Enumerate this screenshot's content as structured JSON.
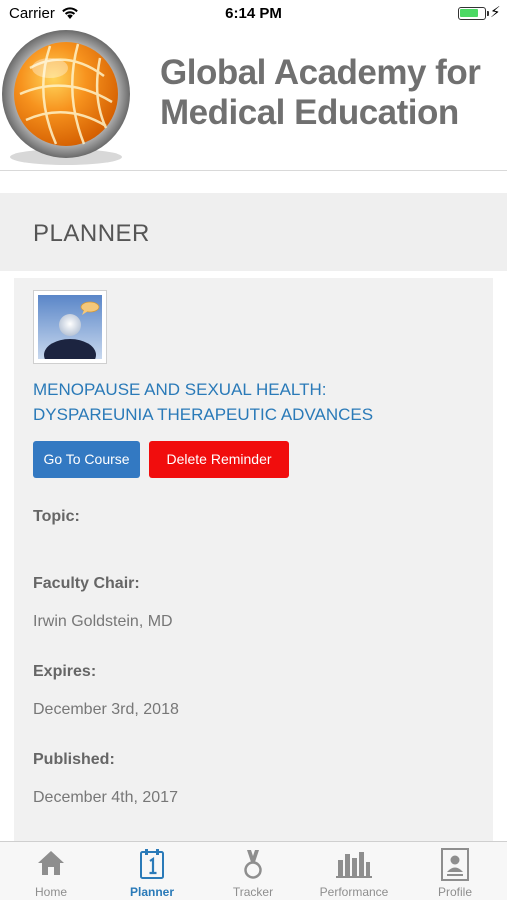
{
  "status_bar": {
    "carrier": "Carrier",
    "time": "6:14 PM",
    "icons": [
      "wifi-icon",
      "battery-icon",
      "charging-bolt-icon"
    ]
  },
  "header": {
    "brand_line1": "Global Academy for",
    "brand_line2": "Medical Education",
    "logo_icon": "globe-logo-icon"
  },
  "page": {
    "title": "PLANNER"
  },
  "course": {
    "thumbnail_icon": "avatar-placeholder-icon",
    "title_line1": "MENOPAUSE AND SEXUAL HEALTH:",
    "title_line2": "DYSPAREUNIA THERAPEUTIC ADVANCES",
    "go_button": "Go To Course",
    "delete_button": "Delete Reminder",
    "topic_label": "Topic:",
    "topic_value": "",
    "faculty_label": "Faculty Chair:",
    "faculty_value": "Irwin Goldstein, MD",
    "expires_label": "Expires:",
    "expires_value": "December 3rd, 2018",
    "published_label": "Published:",
    "published_value": "December 4th, 2017"
  },
  "tab_bar": {
    "active": "Planner",
    "tabs": [
      {
        "label": "Home",
        "icon": "home-icon"
      },
      {
        "label": "Planner",
        "icon": "calendar-icon"
      },
      {
        "label": "Tracker",
        "icon": "medal-icon"
      },
      {
        "label": "Performance",
        "icon": "bar-chart-icon"
      },
      {
        "label": "Profile",
        "icon": "profile-card-icon"
      }
    ]
  },
  "colors": {
    "accent_blue": "#2a7ab8",
    "button_blue": "#3379c2",
    "button_red": "#f10d0d",
    "globe_orange": "#f28b12"
  }
}
